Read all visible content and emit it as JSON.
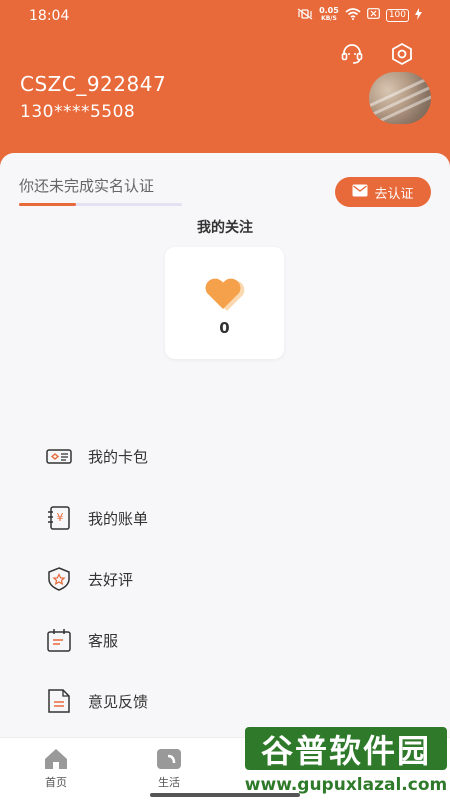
{
  "status_bar": {
    "time": "18:04",
    "net_speed_value": "0.05",
    "net_speed_unit": "KB/S",
    "battery": "100"
  },
  "profile": {
    "username": "CSZC_922847",
    "phone": "130****5508"
  },
  "verification": {
    "prompt": "你还未完成实名认证",
    "button_label": "去认证",
    "progress": 0.35
  },
  "follow": {
    "title": "我的关注",
    "count": "0"
  },
  "menu": {
    "items": [
      {
        "label": "我的卡包",
        "icon": "card-wallet-icon"
      },
      {
        "label": "我的账单",
        "icon": "bill-icon"
      },
      {
        "label": "去好评",
        "icon": "star-shield-icon"
      },
      {
        "label": "客服",
        "icon": "calendar-service-icon"
      },
      {
        "label": "意见反馈",
        "icon": "feedback-document-icon"
      }
    ]
  },
  "tabbar": {
    "tabs": [
      {
        "label": "首页"
      },
      {
        "label": "生活"
      }
    ]
  },
  "watermark": {
    "title": "谷普软件园",
    "url": "www.gupuxlazal.com"
  },
  "colors": {
    "accent": "#E8693A",
    "background": "#f7f7f9",
    "watermark_green": "#2f7a2a"
  }
}
